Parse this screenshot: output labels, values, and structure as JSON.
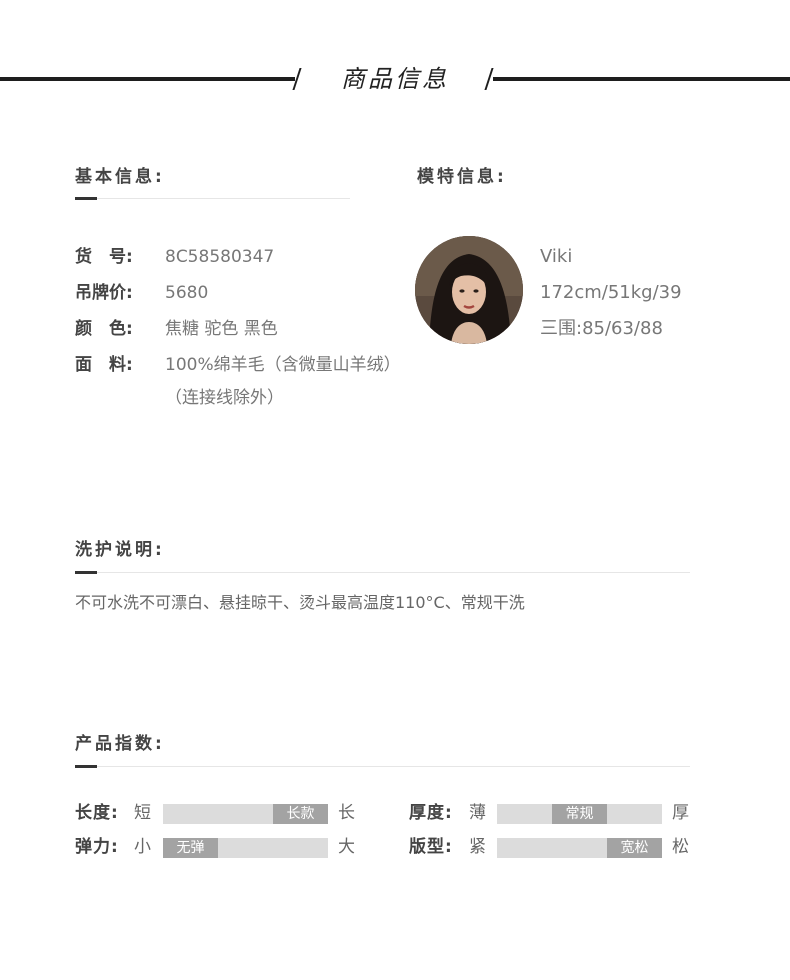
{
  "header": {
    "title": "商品信息"
  },
  "basic": {
    "title": "基本信息:",
    "rows": [
      {
        "label": "货　号:",
        "value": "8C58580347"
      },
      {
        "label": "吊牌价:",
        "value": "5680"
      },
      {
        "label": "颜　色:",
        "value": "焦糖 驼色 黑色"
      },
      {
        "label": "面　料:",
        "value": "100%绵羊毛（含微量山羊绒）",
        "value2": "（连接线除外）"
      }
    ]
  },
  "model": {
    "title": "模特信息:",
    "name": "Viki",
    "size": "172cm/51kg/39",
    "measure": "三围:85/63/88"
  },
  "care": {
    "title": "洗护说明:",
    "text": "不可水洗不可漂白、悬挂晾干、烫斗最高温度110°C、常规干洗"
  },
  "index": {
    "title": "产品指数:",
    "items": [
      {
        "label": "长度:",
        "min": "短",
        "max": "长",
        "tag": "长款",
        "level": 1.0
      },
      {
        "label": "厚度:",
        "min": "薄",
        "max": "厚",
        "tag": "常规",
        "level": 0.5
      },
      {
        "label": "弹力:",
        "min": "小",
        "max": "大",
        "tag": "无弹",
        "level": 0.0
      },
      {
        "label": "版型:",
        "min": "紧",
        "max": "松",
        "tag": "宽松",
        "level": 1.0
      }
    ]
  }
}
